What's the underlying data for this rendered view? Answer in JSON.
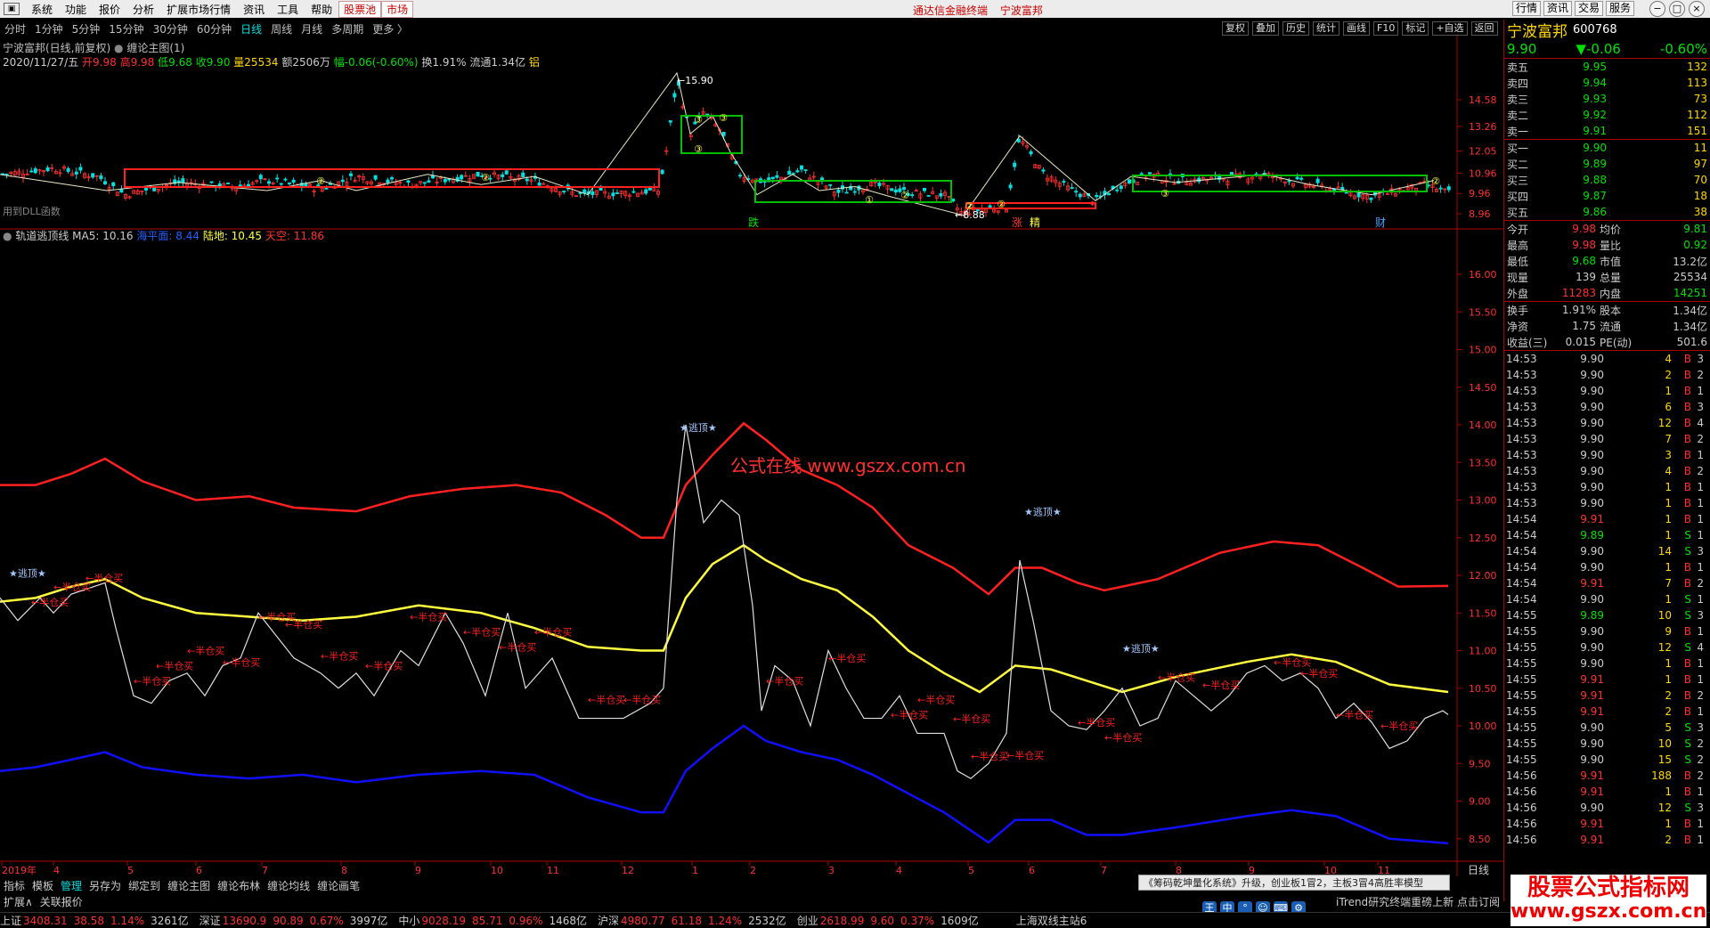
{
  "menu": {
    "items": [
      "系统",
      "功能",
      "报价",
      "分析",
      "扩展市场行情",
      "资讯",
      "工具",
      "帮助"
    ],
    "highlight_items": [
      "股票池",
      "市场"
    ],
    "center_text": [
      "通达信金融终端",
      "宁波富邦"
    ],
    "right_tabs": [
      "行情",
      "资讯",
      "交易",
      "服务"
    ],
    "window_buttons": [
      "−",
      "□",
      "×"
    ]
  },
  "period_bar": {
    "items": [
      "分时",
      "1分钟",
      "5分钟",
      "15分钟",
      "30分钟",
      "60分钟",
      "日线",
      "周线",
      "月线",
      "多周期",
      "更多 〉"
    ],
    "selected": "日线"
  },
  "toolbar_right": [
    "复权",
    "叠加",
    "历史",
    "统计",
    "画线",
    "F10",
    "标记",
    "+自选",
    "返回"
  ],
  "main_header": {
    "title": "宁波富邦(日线,前复权)",
    "indicator": "缠论主图(1)",
    "date": "2020/11/27/五",
    "open": "开9.98",
    "high": "高9.98",
    "low": "低9.68",
    "close": "收9.90",
    "vol": "量25534",
    "amount": "额2506万",
    "change": "幅-0.06(-0.60%)",
    "turnover": "换1.91%",
    "float": "流通1.34亿",
    "tag": "铝",
    "dll_note": "用到DLL函数"
  },
  "main_chart": {
    "y_ticks": [
      "14.58",
      "13.26",
      "12.05",
      "10.96",
      "9.96",
      "8.96"
    ],
    "high_label": "15.90",
    "low_label": "8.88",
    "signals": [
      "跌",
      "涨",
      "精",
      "财"
    ]
  },
  "sub_header": {
    "name": "轨道逃顶线",
    "ma5": "MA5: 10.16",
    "sea": "海平面: 8.44",
    "land": "陆地: 10.45",
    "sky": "天空: 11.86"
  },
  "sub_chart": {
    "y_ticks": [
      "16.00",
      "15.50",
      "15.00",
      "14.50",
      "14.00",
      "13.50",
      "13.00",
      "12.50",
      "12.00",
      "11.50",
      "11.00",
      "10.50",
      "10.00",
      "9.50",
      "9.00",
      "8.50"
    ],
    "escape_label": "★逃顶★",
    "half_label": "←半仓买",
    "watermark": "公式在线  www.gszx.com.cn"
  },
  "x_axis": [
    "2019年",
    "4",
    "5",
    "6",
    "7",
    "8",
    "9",
    "10",
    "11",
    "12",
    "1",
    "2",
    "3",
    "4",
    "5",
    "6",
    "7",
    "8",
    "9",
    "10",
    "11"
  ],
  "right_panel": {
    "name": "宁波富邦",
    "code": "600768",
    "price": "9.90",
    "change": "▼-0.06",
    "pct": "-0.60%",
    "asks": [
      {
        "l": "卖五",
        "p": "9.95",
        "v": "132"
      },
      {
        "l": "卖四",
        "p": "9.94",
        "v": "113"
      },
      {
        "l": "卖三",
        "p": "9.93",
        "v": "73"
      },
      {
        "l": "卖二",
        "p": "9.92",
        "v": "112"
      },
      {
        "l": "卖一",
        "p": "9.91",
        "v": "151"
      }
    ],
    "bids": [
      {
        "l": "买一",
        "p": "9.90",
        "v": "11"
      },
      {
        "l": "买二",
        "p": "9.89",
        "v": "97"
      },
      {
        "l": "买三",
        "p": "9.88",
        "v": "70"
      },
      {
        "l": "买四",
        "p": "9.87",
        "v": "18"
      },
      {
        "l": "买五",
        "p": "9.86",
        "v": "38"
      }
    ],
    "stats": [
      {
        "l": "今开",
        "v": "9.98",
        "l2": "均价",
        "v2": "9.81"
      },
      {
        "l": "最高",
        "v": "9.98",
        "l2": "量比",
        "v2": "0.92"
      },
      {
        "l": "最低",
        "v": "9.68",
        "l2": "市值",
        "v2": "13.2亿"
      },
      {
        "l": "现量",
        "v": "139",
        "l2": "总量",
        "v2": "25534"
      },
      {
        "l": "外盘",
        "v": "11283",
        "l2": "内盘",
        "v2": "14251"
      }
    ],
    "stats2": [
      {
        "l": "换手",
        "v": "1.91%",
        "l2": "股本",
        "v2": "1.34亿"
      },
      {
        "l": "净资",
        "v": "1.75",
        "l2": "流通",
        "v2": "1.34亿"
      },
      {
        "l": "收益(三)",
        "v": "0.015",
        "l2": "PE(动)",
        "v2": "501.6"
      }
    ],
    "ticks": [
      {
        "t": "14:53",
        "p": "9.90",
        "q": "4",
        "d": "B",
        "e": "3"
      },
      {
        "t": "14:53",
        "p": "9.90",
        "q": "2",
        "d": "B",
        "e": "2"
      },
      {
        "t": "14:53",
        "p": "9.90",
        "q": "1",
        "d": "B",
        "e": "1"
      },
      {
        "t": "14:53",
        "p": "9.90",
        "q": "6",
        "d": "B",
        "e": "3"
      },
      {
        "t": "14:53",
        "p": "9.90",
        "q": "12",
        "d": "B",
        "e": "4"
      },
      {
        "t": "14:53",
        "p": "9.90",
        "q": "7",
        "d": "B",
        "e": "2"
      },
      {
        "t": "14:53",
        "p": "9.90",
        "q": "3",
        "d": "B",
        "e": "1"
      },
      {
        "t": "14:53",
        "p": "9.90",
        "q": "4",
        "d": "B",
        "e": "2"
      },
      {
        "t": "14:53",
        "p": "9.90",
        "q": "1",
        "d": "B",
        "e": "1"
      },
      {
        "t": "14:53",
        "p": "9.90",
        "q": "1",
        "d": "B",
        "e": "1"
      },
      {
        "t": "14:54",
        "p": "9.91",
        "q": "1",
        "d": "B",
        "e": "1"
      },
      {
        "t": "14:54",
        "p": "9.89",
        "q": "1",
        "d": "S",
        "e": "1"
      },
      {
        "t": "14:54",
        "p": "9.90",
        "q": "14",
        "d": "S",
        "e": "3"
      },
      {
        "t": "14:54",
        "p": "9.90",
        "q": "1",
        "d": "B",
        "e": "1"
      },
      {
        "t": "14:54",
        "p": "9.91",
        "q": "7",
        "d": "B",
        "e": "2"
      },
      {
        "t": "14:54",
        "p": "9.90",
        "q": "1",
        "d": "S",
        "e": "1"
      },
      {
        "t": "14:55",
        "p": "9.89",
        "q": "10",
        "d": "S",
        "e": "3"
      },
      {
        "t": "14:55",
        "p": "9.90",
        "q": "9",
        "d": "B",
        "e": "1"
      },
      {
        "t": "14:55",
        "p": "9.90",
        "q": "12",
        "d": "S",
        "e": "4"
      },
      {
        "t": "14:55",
        "p": "9.90",
        "q": "1",
        "d": "B",
        "e": "1"
      },
      {
        "t": "14:55",
        "p": "9.91",
        "q": "1",
        "d": "B",
        "e": "1"
      },
      {
        "t": "14:55",
        "p": "9.91",
        "q": "2",
        "d": "B",
        "e": "2"
      },
      {
        "t": "14:55",
        "p": "9.91",
        "q": "2",
        "d": "B",
        "e": "1"
      },
      {
        "t": "14:55",
        "p": "9.90",
        "q": "5",
        "d": "S",
        "e": "3"
      },
      {
        "t": "14:55",
        "p": "9.90",
        "q": "10",
        "d": "S",
        "e": "2"
      },
      {
        "t": "14:55",
        "p": "9.90",
        "q": "15",
        "d": "S",
        "e": "2"
      },
      {
        "t": "14:56",
        "p": "9.91",
        "q": "188",
        "d": "B",
        "e": "2"
      },
      {
        "t": "14:56",
        "p": "9.91",
        "q": "1",
        "d": "B",
        "e": "1"
      },
      {
        "t": "14:56",
        "p": "9.90",
        "q": "12",
        "d": "S",
        "e": "3"
      },
      {
        "t": "14:56",
        "p": "9.91",
        "q": "1",
        "d": "B",
        "e": "1"
      },
      {
        "t": "14:56",
        "p": "9.91",
        "q": "2",
        "d": "B",
        "e": "1"
      }
    ]
  },
  "bottom_tabs": [
    "指标",
    "模板",
    "管理",
    "另存为",
    "绑定到",
    "缠论主图",
    "缠论布林",
    "缠论均线",
    "缠论画笔"
  ],
  "bottom_selected": "管理",
  "bottom2": [
    "扩展∧",
    "关联报价"
  ],
  "day_label": "日线",
  "ad_text": "《筹码乾坤量化系统》升级，创业板1冒2，主板3冒4高胜率模型",
  "ad_text2": "iTrend研究终端重磅上新 点击订阅",
  "watermark": {
    "line1": "股票公式指标网",
    "line2": "www.gszx.com.cn"
  },
  "statusbar": [
    {
      "label": "上证",
      "v": "3408.31",
      "c": "38.58",
      "p": "1.14%",
      "a": "3261亿"
    },
    {
      "label": "深证",
      "v": "13690.9",
      "c": "90.89",
      "p": "0.67%",
      "a": "3997亿"
    },
    {
      "label": "中小",
      "v": "9028.19",
      "c": "85.71",
      "p": "0.96%",
      "a": "1468亿"
    },
    {
      "label": "沪深",
      "v": "4980.77",
      "c": "61.18",
      "p": "1.24%",
      "a": "2532亿"
    },
    {
      "label": "创业",
      "v": "2618.99",
      "c": "9.60",
      "p": "0.37%",
      "a": "1609亿"
    }
  ],
  "status_station": "上海双线主站6",
  "colors": {
    "red": "#ff2020",
    "green": "#00e000",
    "yellow": "#ffff40",
    "blue": "#1010ff",
    "white": "#e8e8e8",
    "axisred": "#b00000"
  }
}
